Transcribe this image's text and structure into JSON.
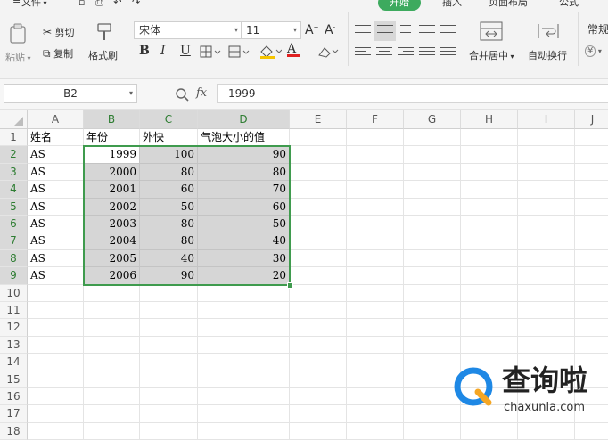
{
  "ribbon": {
    "tabs": {
      "file": "文件",
      "home": "开始",
      "insert": "插入",
      "page_layout": "页面布局",
      "formulas": "公式"
    },
    "clipboard": {
      "paste": "粘贴",
      "cut": "剪切",
      "copy": "复制",
      "format_painter": "格式刷"
    },
    "font": {
      "name": "宋体",
      "size": "11",
      "bold": "B",
      "italic": "I",
      "underline": "U",
      "font_color_glyph": "A"
    },
    "merge_label": "合并居中",
    "wrap_label": "自动换行",
    "number_format": "常规",
    "currency_glyph": "¥"
  },
  "formula_bar": {
    "name_box": "B2",
    "fx_label": "fx",
    "value": "1999"
  },
  "columns": [
    "A",
    "B",
    "C",
    "D",
    "E",
    "F",
    "G",
    "H",
    "I",
    "J"
  ],
  "rows": [
    "1",
    "2",
    "3",
    "4",
    "5",
    "6",
    "7",
    "8",
    "9",
    "10",
    "11",
    "12",
    "13",
    "14",
    "15",
    "16",
    "17",
    "18"
  ],
  "selected_range": "B2:D9",
  "sheet": {
    "header": [
      "姓名",
      "年份",
      "外快",
      "气泡大小的值"
    ],
    "data": [
      [
        "AS",
        "1999",
        "100",
        "90"
      ],
      [
        "AS",
        "2000",
        "80",
        "80"
      ],
      [
        "AS",
        "2001",
        "60",
        "70"
      ],
      [
        "AS",
        "2002",
        "50",
        "60"
      ],
      [
        "AS",
        "2003",
        "80",
        "50"
      ],
      [
        "AS",
        "2004",
        "80",
        "40"
      ],
      [
        "AS",
        "2005",
        "40",
        "30"
      ],
      [
        "AS",
        "2006",
        "90",
        "20"
      ]
    ]
  },
  "watermark": {
    "brand": "查询啦",
    "url": "chaxunla.com"
  },
  "colors": {
    "accent": "#3daa5e",
    "selection_border": "#3f9b4e",
    "selection_fill": "#d6d6d6",
    "watermark_blue": "#1e88e5",
    "watermark_orange": "#f5a623"
  }
}
